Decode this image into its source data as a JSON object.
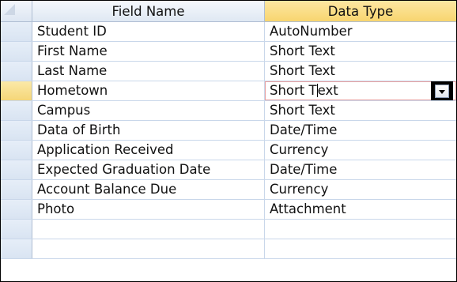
{
  "header": {
    "field_name": "Field Name",
    "data_type": "Data Type"
  },
  "rows": [
    {
      "field_name": "Student ID",
      "data_type": "AutoNumber"
    },
    {
      "field_name": "First Name",
      "data_type": "Short Text"
    },
    {
      "field_name": "Last Name",
      "data_type": "Short Text"
    },
    {
      "field_name": "Hometown",
      "data_type_before_caret": "Short T",
      "data_type_after_caret": "ext",
      "data_type": "Short Text"
    },
    {
      "field_name": "Campus",
      "data_type": "Short Text"
    },
    {
      "field_name": "Data of Birth",
      "data_type": "Date/Time"
    },
    {
      "field_name": "Application Received",
      "data_type": "Currency"
    },
    {
      "field_name": "Expected Graduation Date",
      "data_type": "Date/Time"
    },
    {
      "field_name": "Account Balance Due",
      "data_type": "Currency"
    },
    {
      "field_name": "Photo",
      "data_type": "Attachment"
    }
  ],
  "current_row_index": 3,
  "icons": {
    "dropdown": "chevron-down-icon",
    "corner": "select-all-corner-icon"
  },
  "colors": {
    "current_row_selector": "#f5d678",
    "data_type_header": "#f8d56f",
    "grid_line": "#c9d7ea"
  }
}
